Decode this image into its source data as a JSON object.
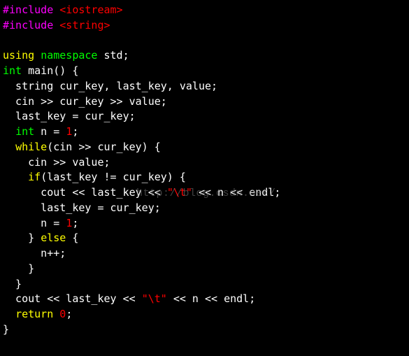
{
  "code": {
    "include1_kw": "#include",
    "include1_hdr": "<iostream>",
    "include2_kw": "#include",
    "include2_hdr": "<string>",
    "using_kw": "using",
    "namespace_kw": "namespace",
    "std_txt": "std;",
    "int_kw": "int",
    "main_sig": "main() {",
    "decl_line": "  string cur_key, last_key, value;",
    "cin1_line": "  cin >> cur_key >> value;",
    "assign1_line": "  last_key = cur_key;",
    "int_n_kw": "int",
    "int_n_rest": " n = ",
    "one_a": "1",
    "semi_a": ";",
    "while_kw": "while",
    "while_cond": "(cin >> cur_key) {",
    "cin2_line": "    cin >> value;",
    "if_kw": "if",
    "if_cond": "(last_key != cur_key) {",
    "cout1_a": "      cout << last_key << ",
    "tab_str1": "\"\\t\"",
    "cout1_b": " << n << endl;",
    "assign2_line": "      last_key = cur_key;",
    "n_eq": "      n = ",
    "one_b": "1",
    "semi_b": ";",
    "close_if": "    } ",
    "else_kw": "else",
    "open_else": " {",
    "npp_line": "      n++;",
    "close_else": "    }",
    "close_while": "  }",
    "cout2_a": "  cout << last_key << ",
    "tab_str2": "\"\\t\"",
    "cout2_b": " << n << endl;",
    "return_kw": "return",
    "zero": "0",
    "semi_c": ";",
    "close_main": "}"
  },
  "watermark": "http://blog.csdn.net/"
}
